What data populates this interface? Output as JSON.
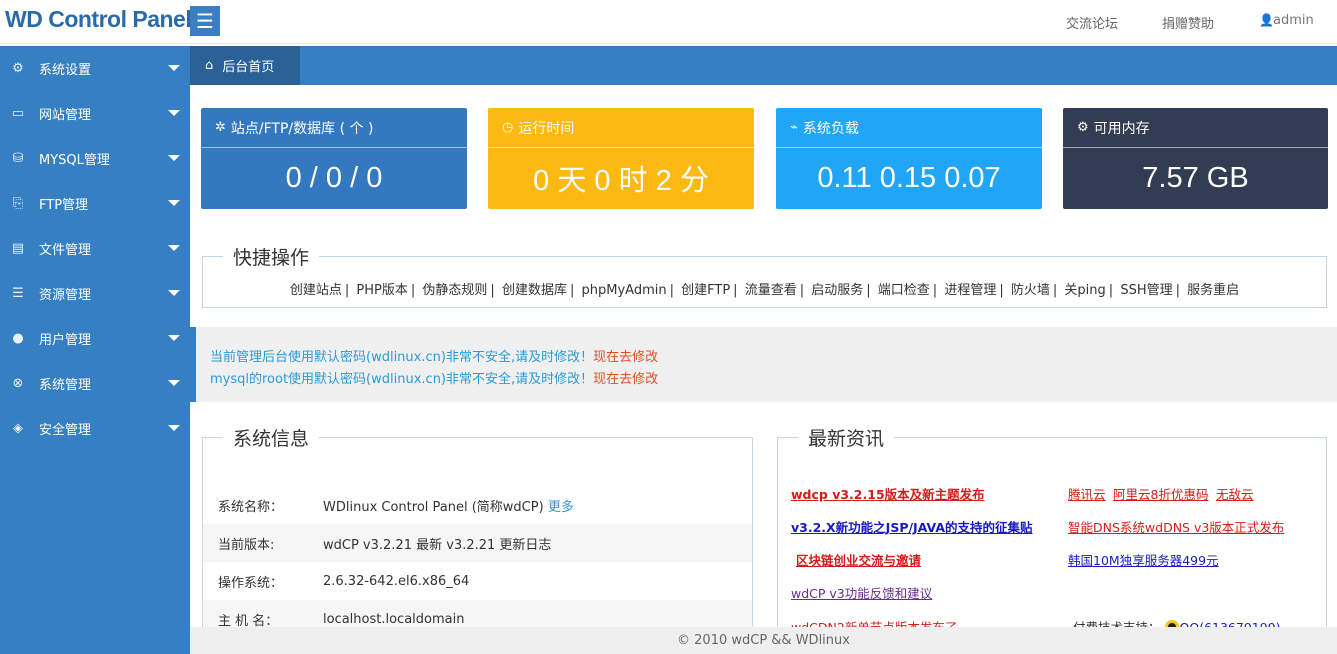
{
  "app": {
    "logo": "WD Control Panel",
    "menu_icon": "hamburger-icon"
  },
  "topnav": {
    "forum": "交流论坛",
    "donate": "捐赠赞助",
    "admin": "admin"
  },
  "sidebar": {
    "items": [
      {
        "label": "系统设置",
        "icon": "gear-icon"
      },
      {
        "label": "网站管理",
        "icon": "monitor-icon"
      },
      {
        "label": "MYSQL管理",
        "icon": "database-icon"
      },
      {
        "label": "FTP管理",
        "icon": "ftp-icon"
      },
      {
        "label": "文件管理",
        "icon": "file-icon"
      },
      {
        "label": "资源管理",
        "icon": "server-icon"
      },
      {
        "label": "用户管理",
        "icon": "user-icon"
      },
      {
        "label": "系统管理",
        "icon": "system-icon"
      },
      {
        "label": "安全管理",
        "icon": "shield-icon"
      }
    ]
  },
  "breadcrumb": {
    "home": "后台首页"
  },
  "stats": [
    {
      "title": "站点/FTP/数据库 ( 个 )",
      "value": "0 / 0 / 0",
      "icon": "sites-icon",
      "color": "#3478c0"
    },
    {
      "title": "运行时间",
      "value": "0 天 0 时 2 分",
      "icon": "clock-icon",
      "color": "#fbb911"
    },
    {
      "title": "系统负载",
      "value": "0.11 0.15 0.07",
      "icon": "pulse-icon",
      "color": "#20a5f7"
    },
    {
      "title": "可用内存",
      "value": "7.57 GB",
      "icon": "memory-icon",
      "color": "#323c52"
    }
  ],
  "quick": {
    "title": "快捷操作",
    "links": [
      "创建站点",
      "PHP版本",
      "伪静态规则",
      "创建数据库",
      "phpMyAdmin",
      "创建FTP",
      "流量查看",
      "启动服务",
      "端口检查",
      "进程管理",
      "防火墙",
      "关ping",
      "SSH管理",
      "服务重启"
    ]
  },
  "alerts": [
    {
      "text": "当前管理后台使用默认密码(wdlinux.cn)非常不安全,请及时修改！",
      "link": "现在去修改"
    },
    {
      "text": "mysql的root使用默认密码(wdlinux.cn)非常不安全,请及时修改！",
      "link": "现在去修改"
    }
  ],
  "sysinfo": {
    "title": "系统信息",
    "rows": [
      {
        "key": "系统名称：",
        "value": "WDlinux Control Panel (简称wdCP)",
        "link": "更多"
      },
      {
        "key": "当前版本:",
        "value": "wdCP v3.2.21 最新 v3.2.21 更新日志",
        "link": ""
      },
      {
        "key": "操作系统：",
        "value": "2.6.32-642.el6.x86_64",
        "link": ""
      },
      {
        "key": "主 机 名：",
        "value": "localhost.localdomain",
        "link": ""
      }
    ]
  },
  "news": {
    "title": "最新资讯",
    "left": [
      "wdcp v3.2.15版本及新主题发布",
      "v3.2.X新功能之JSP/JAVA的支持的征集贴",
      "区块链创业交流与邀请",
      "wdCP v3功能反馈和建议",
      "wdCDN2新单节点版本发布了"
    ],
    "right_1": [
      "腾讯云",
      "阿里云8折优惠码",
      "无敌云"
    ],
    "right_2": "智能DNS系统wdDNS v3版本正式发布",
    "right_3": "韩国10M独享服务器499元",
    "support_label": "付费技术支持：",
    "support_qq": "QQ(613679199)"
  },
  "footer": {
    "text": "© 2010 wdCP && WDlinux"
  }
}
